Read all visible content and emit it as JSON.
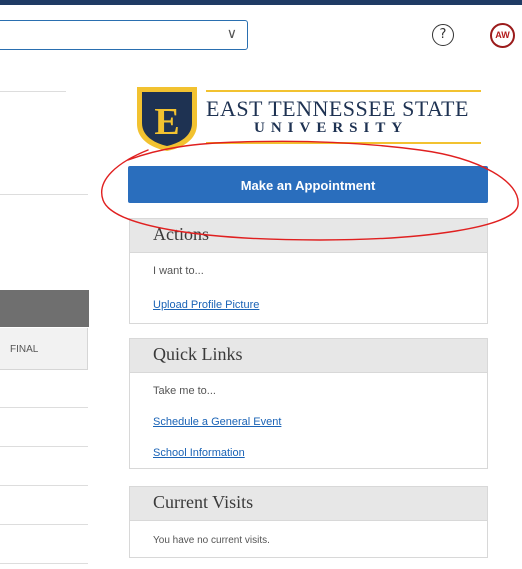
{
  "header": {
    "select_chevron": "∨",
    "help_symbol": "?",
    "avatar_initials": "AW"
  },
  "logo": {
    "letter": "E",
    "name": "EAST TENNESSEE STATE",
    "subtitle": "UNIVERSITY"
  },
  "appointment_button": "Make an Appointment",
  "actions": {
    "title": "Actions",
    "prompt": "I want to...",
    "link": "Upload Profile Picture"
  },
  "quick_links": {
    "title": "Quick Links",
    "prompt": "Take me to...",
    "links": [
      "Schedule a General Event",
      "School Information"
    ]
  },
  "current_visits": {
    "title": "Current Visits",
    "message": "You have no current visits."
  },
  "left_table": {
    "column_header": "FINAL"
  },
  "colors": {
    "primary_blue": "#2a6ebd",
    "navy": "#1e3252",
    "gold": "#f2c230",
    "annotation_red": "#e02020"
  }
}
